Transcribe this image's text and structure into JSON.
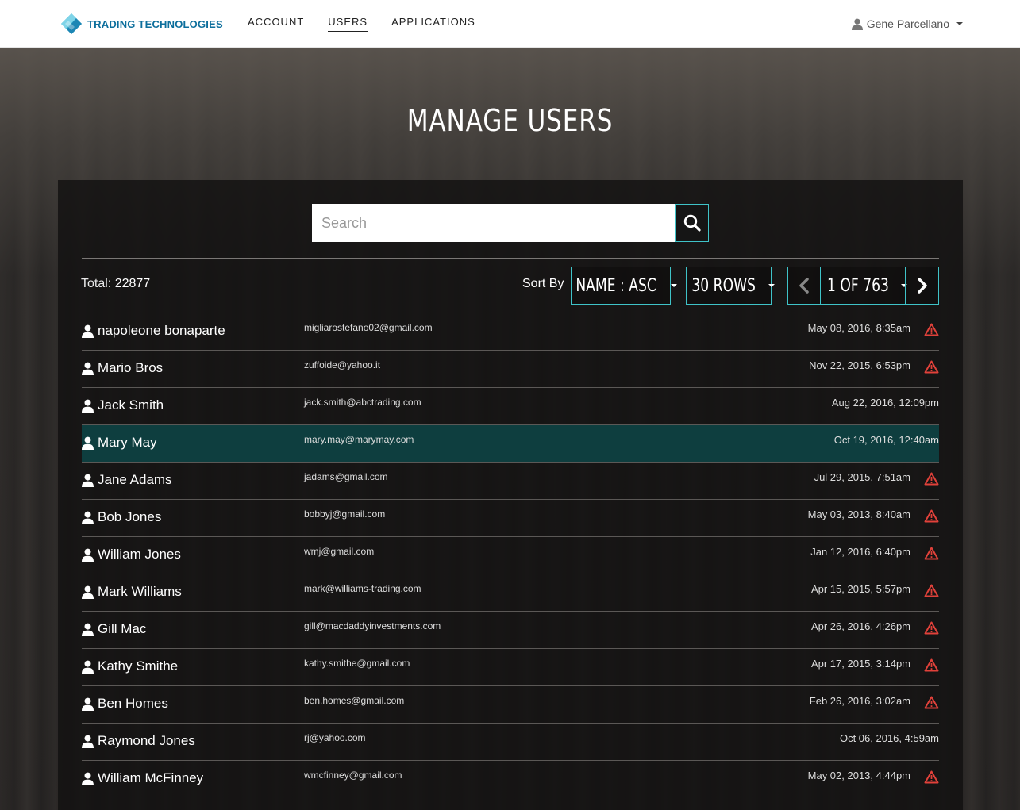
{
  "brand": {
    "name": "TRADING TECHNOLOGIES"
  },
  "nav": [
    {
      "label": "ACCOUNT",
      "active": false
    },
    {
      "label": "USERS",
      "active": true
    },
    {
      "label": "APPLICATIONS",
      "active": false
    }
  ],
  "user_menu": {
    "name": "Gene Parcellano"
  },
  "page": {
    "title": "MANAGE USERS"
  },
  "search": {
    "placeholder": "Search"
  },
  "summary": {
    "total_label": "Total:",
    "total_value": "22877"
  },
  "sort": {
    "label": "Sort By",
    "value": "NAME : ASC"
  },
  "rows_per_page": {
    "value": "30 ROWS"
  },
  "pagination": {
    "value": "1 OF 763"
  },
  "colors": {
    "accent": "#3fc3c8",
    "selected_row": "#0e3e3f",
    "warning": "#e0413a"
  },
  "users": [
    {
      "name": "napoleone bonaparte",
      "email": "migliarostefano02@gmail.com",
      "date": "May 08, 2016, 8:35am",
      "warning": true,
      "selected": false
    },
    {
      "name": "Mario Bros",
      "email": "zuffoide@yahoo.it",
      "date": "Nov 22, 2015, 6:53pm",
      "warning": true,
      "selected": false
    },
    {
      "name": "Jack Smith",
      "email": "jack.smith@abctrading.com",
      "date": "Aug 22, 2016, 12:09pm",
      "warning": false,
      "selected": false
    },
    {
      "name": "Mary May",
      "email": "mary.may@marymay.com",
      "date": "Oct 19, 2016, 12:40am",
      "warning": false,
      "selected": true
    },
    {
      "name": "Jane Adams",
      "email": "jadams@gmail.com",
      "date": "Jul 29, 2015, 7:51am",
      "warning": true,
      "selected": false
    },
    {
      "name": "Bob Jones",
      "email": "bobbyj@gmail.com",
      "date": "May 03, 2013, 8:40am",
      "warning": true,
      "selected": false
    },
    {
      "name": "William Jones",
      "email": "wmj@gmail.com",
      "date": "Jan 12, 2016, 6:40pm",
      "warning": true,
      "selected": false
    },
    {
      "name": "Mark Williams",
      "email": "mark@williams-trading.com",
      "date": "Apr 15, 2015, 5:57pm",
      "warning": true,
      "selected": false
    },
    {
      "name": "Gill Mac",
      "email": "gill@macdaddyinvestments.com",
      "date": "Apr 26, 2016, 4:26pm",
      "warning": true,
      "selected": false
    },
    {
      "name": "Kathy Smithe",
      "email": "kathy.smithe@gmail.com",
      "date": "Apr 17, 2015, 3:14pm",
      "warning": true,
      "selected": false
    },
    {
      "name": "Ben Homes",
      "email": "ben.homes@gmail.com",
      "date": "Feb 26, 2016, 3:02am",
      "warning": true,
      "selected": false
    },
    {
      "name": "Raymond Jones",
      "email": "rj@yahoo.com",
      "date": "Oct 06, 2016, 4:59am",
      "warning": false,
      "selected": false
    },
    {
      "name": "William McFinney",
      "email": "wmcfinney@gmail.com",
      "date": "May 02, 2013, 4:44pm",
      "warning": true,
      "selected": false
    }
  ]
}
